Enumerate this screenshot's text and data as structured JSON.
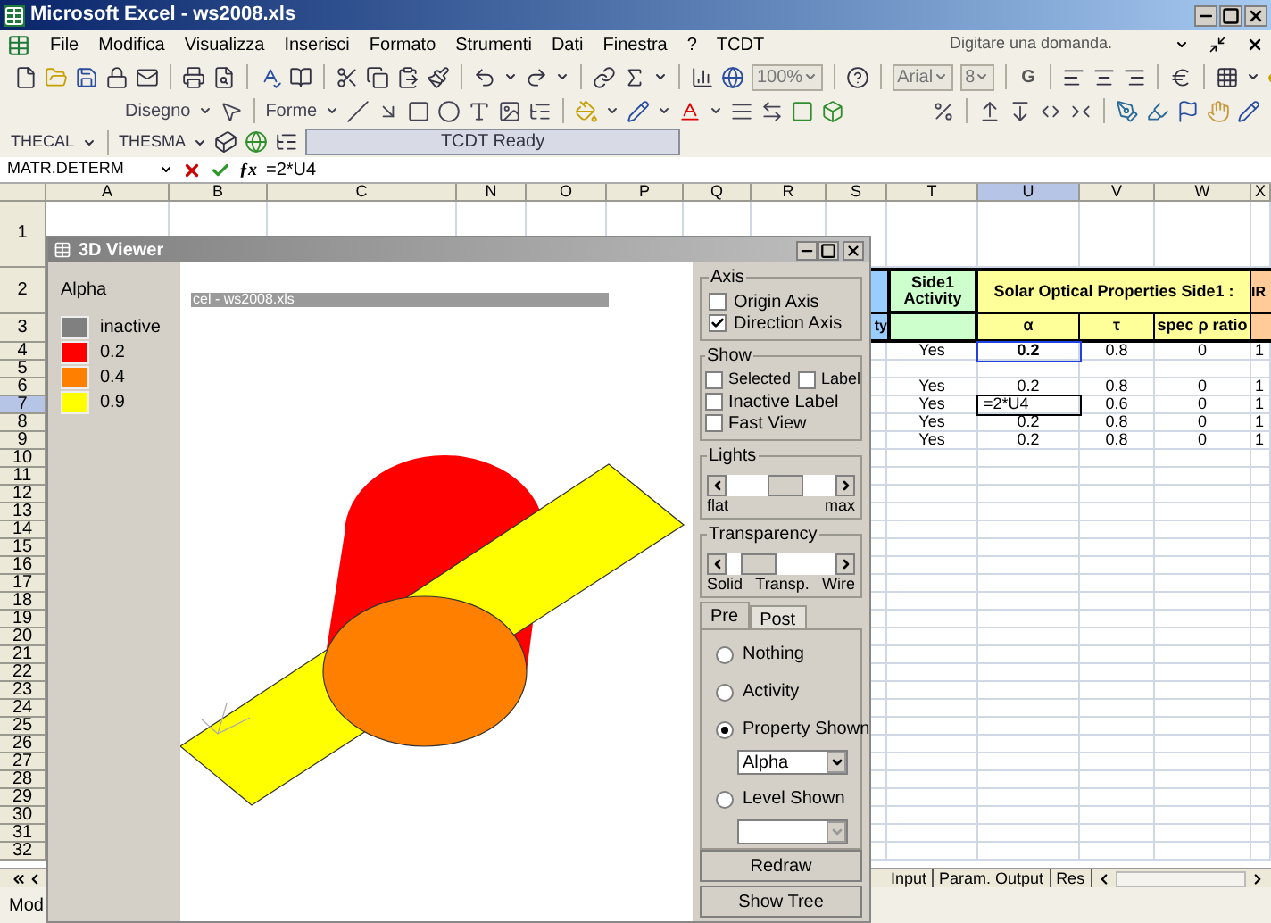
{
  "window": {
    "title": "Microsoft Excel - ws2008.xls"
  },
  "menu": [
    "File",
    "Modifica",
    "Visualizza",
    "Inserisci",
    "Formato",
    "Strumenti",
    "Dati",
    "Finestra",
    "?",
    "TCDT"
  ],
  "help_box": {
    "placeholder": "Digitare una domanda."
  },
  "standard_toolbar": {
    "zoom": "100%",
    "font": "Arial",
    "font_size": "8",
    "bold_button": "G"
  },
  "drawing_toolbar": {
    "draw_menu": "Disegno",
    "shapes_menu": "Forme"
  },
  "tcdt_toolbar": {
    "thecal_menu": "THECAL",
    "thesma_menu": "THESMA",
    "status": "TCDT Ready"
  },
  "formula_bar": {
    "name_box": "MATR.DETERM",
    "fx_label": "ƒx",
    "formula": "=2*U4"
  },
  "columns": [
    {
      "label": "A",
      "selected": false
    },
    {
      "label": "B",
      "selected": false
    },
    {
      "label": "C",
      "selected": false
    },
    {
      "label": "N",
      "selected": false
    },
    {
      "label": "O",
      "selected": false
    },
    {
      "label": "P",
      "selected": false
    },
    {
      "label": "Q",
      "selected": false
    },
    {
      "label": "R",
      "selected": false
    },
    {
      "label": "S",
      "selected": false
    },
    {
      "label": "T",
      "selected": false
    },
    {
      "label": "U",
      "selected": true
    },
    {
      "label": "V",
      "selected": false
    },
    {
      "label": "W",
      "selected": false
    },
    {
      "label": "X",
      "selected": false
    }
  ],
  "table_header": {
    "side_cell": {
      "text": "ty",
      "color": "#99ccff"
    },
    "activity": {
      "text": "Side1 Activity",
      "color": "#ccffcc"
    },
    "solar": {
      "text": "Solar Optical Properties Side1 :",
      "color": "#ffff99",
      "columns": [
        "α",
        "τ",
        "spec ρ ratio"
      ]
    },
    "ir": {
      "text": "IR",
      "color": "#ffcc99"
    }
  },
  "rows": [
    {
      "label": "1",
      "selected": false
    },
    {
      "label": "2",
      "selected": false
    },
    {
      "label": "3",
      "selected": false
    },
    {
      "label": "4",
      "selected": false,
      "cells": {
        "activity": "Yes",
        "alpha": "0.2",
        "tau": "0.8",
        "spec": "0",
        "ir": "1"
      },
      "referenced": true,
      "editing": false
    },
    {
      "label": "5",
      "selected": false
    },
    {
      "label": "6",
      "selected": false,
      "cells": {
        "activity": "Yes",
        "alpha": "0.2",
        "tau": "0.8",
        "spec": "0",
        "ir": "1"
      },
      "referenced": false,
      "editing": false
    },
    {
      "label": "7",
      "selected": true,
      "cells": {
        "activity": "Yes",
        "alpha": "=2*U4",
        "tau": "0.6",
        "spec": "0",
        "ir": "1"
      },
      "referenced": false,
      "editing": true
    },
    {
      "label": "8",
      "selected": false,
      "cells": {
        "activity": "Yes",
        "alpha": "0.2",
        "tau": "0.8",
        "spec": "0",
        "ir": "1"
      },
      "referenced": false,
      "editing": false
    },
    {
      "label": "9",
      "selected": false,
      "cells": {
        "activity": "Yes",
        "alpha": "0.2",
        "tau": "0.8",
        "spec": "0",
        "ir": "1"
      },
      "referenced": false,
      "editing": false
    },
    {
      "label": "10",
      "selected": false
    },
    {
      "label": "11",
      "selected": false
    },
    {
      "label": "12",
      "selected": false
    },
    {
      "label": "13",
      "selected": false
    },
    {
      "label": "14",
      "selected": false
    },
    {
      "label": "15",
      "selected": false
    },
    {
      "label": "16",
      "selected": false
    },
    {
      "label": "17",
      "selected": false
    },
    {
      "label": "18",
      "selected": false
    },
    {
      "label": "19",
      "selected": false
    },
    {
      "label": "20",
      "selected": false
    },
    {
      "label": "21",
      "selected": false
    },
    {
      "label": "22",
      "selected": false
    },
    {
      "label": "23",
      "selected": false
    },
    {
      "label": "24",
      "selected": false
    },
    {
      "label": "25",
      "selected": false
    },
    {
      "label": "26",
      "selected": false
    },
    {
      "label": "27",
      "selected": false
    },
    {
      "label": "28",
      "selected": false
    },
    {
      "label": "29",
      "selected": false
    },
    {
      "label": "30",
      "selected": false
    },
    {
      "label": "31",
      "selected": false
    },
    {
      "label": "32",
      "selected": false
    }
  ],
  "sheet_tabs": [
    {
      "label": "Input",
      "selected": false
    },
    {
      "label": "Param. Output",
      "selected": false
    },
    {
      "label": "Res",
      "selected": false
    }
  ],
  "status_bar": {
    "mode": "Mod"
  },
  "viewer": {
    "title": "3D Viewer",
    "legend_title": "Alpha",
    "legend": [
      {
        "label": "inactive",
        "color": "#808080"
      },
      {
        "label": "0.2",
        "color": "#ff0000"
      },
      {
        "label": "0.4",
        "color": "#ff8000"
      },
      {
        "label": "0.9",
        "color": "#ffff00"
      }
    ],
    "caption": "cel - ws2008.xls",
    "axis": {
      "label": "Axis",
      "options": [
        {
          "label": "Origin Axis",
          "checked": false
        },
        {
          "label": "Direction Axis",
          "checked": true
        }
      ]
    },
    "show": {
      "label": "Show",
      "options": [
        {
          "label": "Selected",
          "checked": false
        },
        {
          "label": "Label",
          "checked": false
        },
        {
          "label": "Inactive Label",
          "checked": false
        },
        {
          "label": "Fast View",
          "checked": false
        }
      ]
    },
    "lights": {
      "label": "Lights",
      "level": 0.55,
      "labels": [
        "flat",
        "max"
      ]
    },
    "transparency": {
      "label": "Transparency",
      "level": 0.2,
      "labels": [
        "Solid",
        "Transp.",
        "Wire"
      ]
    },
    "tabs": [
      {
        "label": "Pre",
        "selected": true
      },
      {
        "label": "Post",
        "selected": false
      }
    ],
    "modes": [
      {
        "label": "Nothing",
        "selected": false
      },
      {
        "label": "Activity",
        "selected": false
      },
      {
        "label": "Property Shown",
        "selected": true,
        "dropdown": {
          "value": "Alpha",
          "disabled": false
        }
      },
      {
        "label": "Level Shown",
        "selected": false,
        "dropdown": {
          "disabled": true
        }
      }
    ],
    "buttons": [
      "Redraw",
      "Show Tree"
    ]
  }
}
